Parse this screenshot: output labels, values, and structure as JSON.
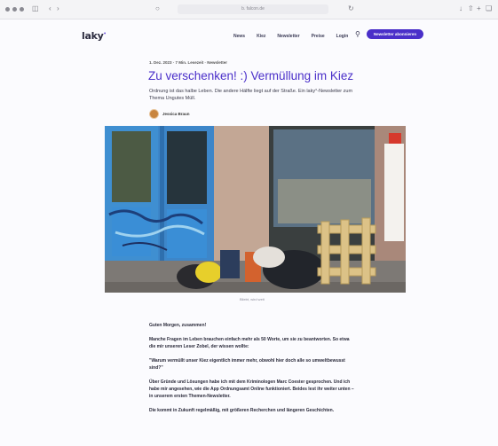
{
  "browser": {
    "url": "b. falcon.de"
  },
  "header": {
    "logo": "laky",
    "logo_mark": "•",
    "nav": [
      "News",
      "Kiez",
      "Newsletter",
      "Preise",
      "Login"
    ],
    "cta_label": "Newsletter abonnieren"
  },
  "article": {
    "meta": "1. Dez. 2023 · 7 Min. Lesezeit · Newsletter",
    "title": "Zu verschenken! :) Vermüllung im Kiez",
    "subtitle": "Ordnung ist das halbe Leben. Die andere Hälfte liegt auf der Straße. Ein laky°-Newsletter zum Thema Ungutes Müll.",
    "author": "Jessica Braun",
    "image_caption": "Bliebt, wird weit",
    "paragraphs": [
      "Guten Morgen, zusammen!",
      "Manche Fragen im Leben brauchen einfach mehr als 50 Worte, um sie zu beantworten. So etwa die mir unseren Leser Zobel, der wissen wollte:",
      "\"Warum vermüllt unser Kiez eigentlich immer mehr, obwohl hier doch alle so umweltbewusst sind?\"",
      "Über Gründe und Lösungen habe ich mit dem Kriminologen Marc Coester gesprochen. Und ich habe mir angesehen, wie die App Ordnungsamt Online funktioniert. Beides lest ihr weiter unten – in unserem ersten Themen-Newsletter.",
      "Die kommt in Zukunft regelmäßig, mit größeren Recherchen und längeren Geschichten."
    ]
  }
}
